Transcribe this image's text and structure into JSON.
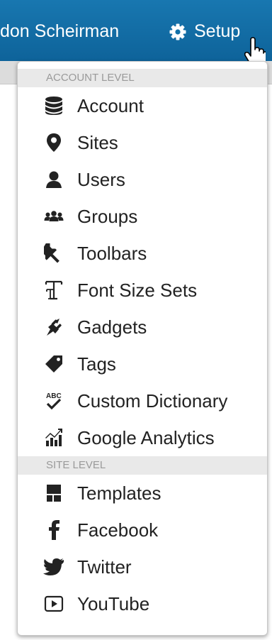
{
  "header": {
    "user_name": "don Scheirman",
    "setup_label": "Setup"
  },
  "menu": {
    "sections": [
      {
        "title": "ACCOUNT LEVEL",
        "items": [
          {
            "label": "Account",
            "icon": "database-icon"
          },
          {
            "label": "Sites",
            "icon": "map-marker-icon"
          },
          {
            "label": "Users",
            "icon": "user-icon"
          },
          {
            "label": "Groups",
            "icon": "group-icon"
          },
          {
            "label": "Toolbars",
            "icon": "wrench-icon"
          },
          {
            "label": "Font Size Sets",
            "icon": "text-height-icon"
          },
          {
            "label": "Gadgets",
            "icon": "plug-icon"
          },
          {
            "label": "Tags",
            "icon": "tag-icon"
          },
          {
            "label": "Custom Dictionary",
            "icon": "spellcheck-icon"
          },
          {
            "label": "Google Analytics",
            "icon": "analytics-icon"
          }
        ]
      },
      {
        "title": "SITE LEVEL",
        "items": [
          {
            "label": "Templates",
            "icon": "template-icon"
          },
          {
            "label": "Facebook",
            "icon": "facebook-icon"
          },
          {
            "label": "Twitter",
            "icon": "twitter-icon"
          },
          {
            "label": "YouTube",
            "icon": "youtube-icon"
          }
        ]
      }
    ]
  },
  "colors": {
    "topbar": "#0e639a",
    "text": "#222222",
    "section_header_bg": "#e9e9e9",
    "section_header_text": "#9a9a9a"
  }
}
